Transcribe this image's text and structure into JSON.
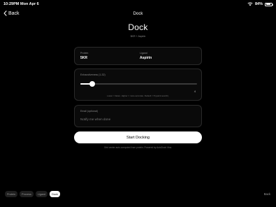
{
  "status_bar": {
    "time": "10:29PM",
    "date": "Mon Apr 6",
    "battery": "84%",
    "battery_level": 0.84
  },
  "nav": {
    "back_label": "Back",
    "title": "Dock"
  },
  "header": {
    "title": "Dock",
    "subtitle": "5KR + Aspirin"
  },
  "molecules": {
    "protein_label": "Protein",
    "protein_value": "5KR",
    "ligand_label": "Ligand",
    "ligand_value": "Aspirin"
  },
  "exhaustiveness": {
    "label": "Exhaustiveness (1-32)",
    "value": "4",
    "level": 0.1,
    "hint": "Lower = faster, Higher = more accurate. Default = 8 (quick search)."
  },
  "email": {
    "label": "Email (optional)",
    "placeholder": "Notify me when done",
    "value": ""
  },
  "actions": {
    "start_label": "Start Docking"
  },
  "footer": {
    "note": "Grid center auto-computed from protein. Powered by AutoDock Vina."
  },
  "tabs": [
    {
      "label": "Protein",
      "active": false
    },
    {
      "label": "Process",
      "active": false
    },
    {
      "label": "Ligand",
      "active": false
    },
    {
      "label": "Dock",
      "active": true
    }
  ],
  "bottom": {
    "back_label": "Back"
  }
}
